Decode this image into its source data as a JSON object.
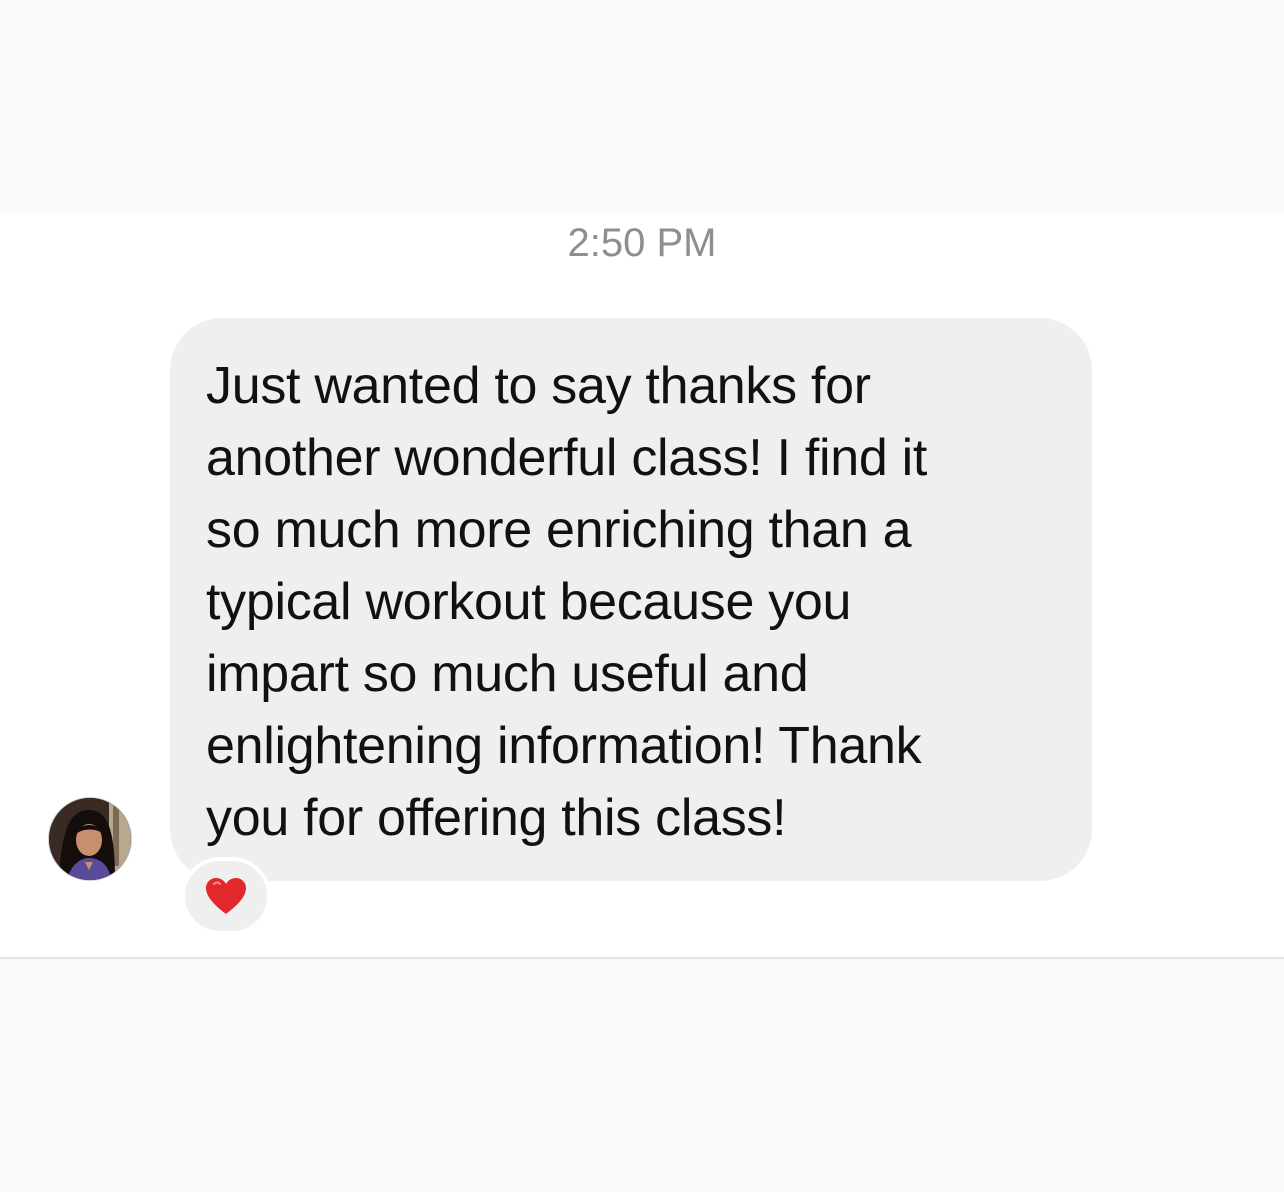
{
  "conversation": {
    "timestamp": "2:50 PM",
    "message": {
      "text": "Just wanted to say thanks for\nanother wonderful class! I find it\nso much more enriching than a\ntypical workout because you\nimpart so much useful and\nenlightening information! Thank\nyou for offering this class!",
      "reaction_icon": "heart-icon",
      "reaction_color": "#e0282d",
      "bubble_color": "#efefef"
    },
    "sender_avatar_icon": "avatar"
  }
}
